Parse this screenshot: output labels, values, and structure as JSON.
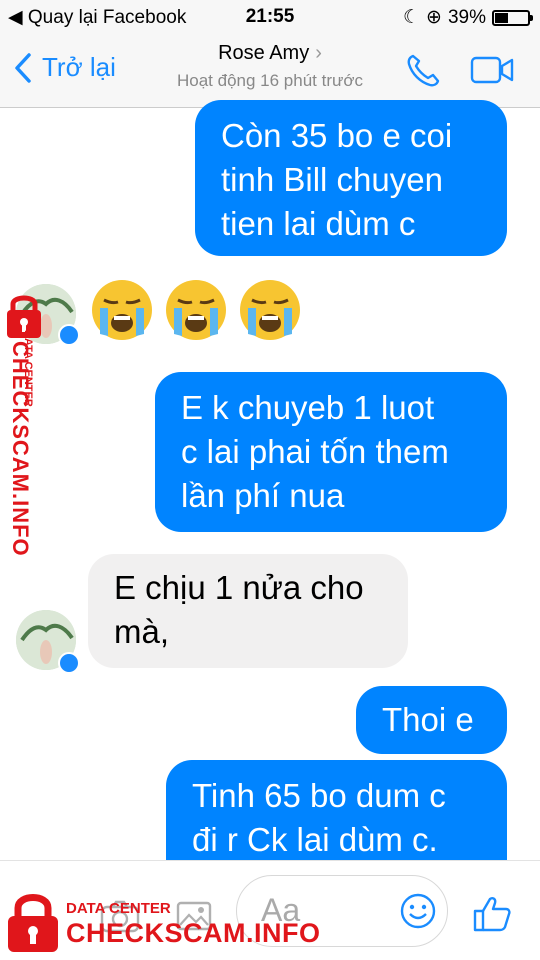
{
  "status_bar": {
    "back_app": "Quay lại Facebook",
    "time": "21:55",
    "battery": "39%",
    "battery_level": 0.39
  },
  "header": {
    "back_label": "Trở lại",
    "contact_name": "Rose Amy",
    "activity": "Hoạt động 16 phút trước",
    "icons": [
      "phone-icon",
      "video-call-icon"
    ]
  },
  "messages": [
    {
      "direction": "outgoing",
      "lines": [
        "Còn 35 bo e coi",
        "tinh Bill chuyen",
        "tien lai dùm c"
      ]
    },
    {
      "direction": "incoming",
      "emoji": [
        "loudly-crying-face",
        "loudly-crying-face",
        "loudly-crying-face"
      ]
    },
    {
      "direction": "outgoing",
      "lines": [
        "E k chuyeb 1 luot",
        "c lai phai tốn them",
        "lần phí nua"
      ]
    },
    {
      "direction": "incoming",
      "lines": [
        "E chịu 1 nửa cho",
        "mà,"
      ]
    },
    {
      "direction": "outgoing",
      "lines": [
        "Thoi e"
      ]
    },
    {
      "direction": "outgoing",
      "lines": [
        "Tinh 65 bo dum c",
        "đi r Ck lai dùm c."
      ]
    }
  ],
  "composer": {
    "placeholder": "Aa",
    "icons": [
      "camera-icon",
      "image-icon",
      "emoji-icon",
      "like-icon"
    ]
  },
  "watermark": {
    "label_small": "DATA CENTER",
    "label_big": "CHECKSCAM.INFO",
    "color": "#e0161b"
  },
  "colors": {
    "accent": "#0084ff",
    "incoming_bubble": "#f1f0f0"
  }
}
